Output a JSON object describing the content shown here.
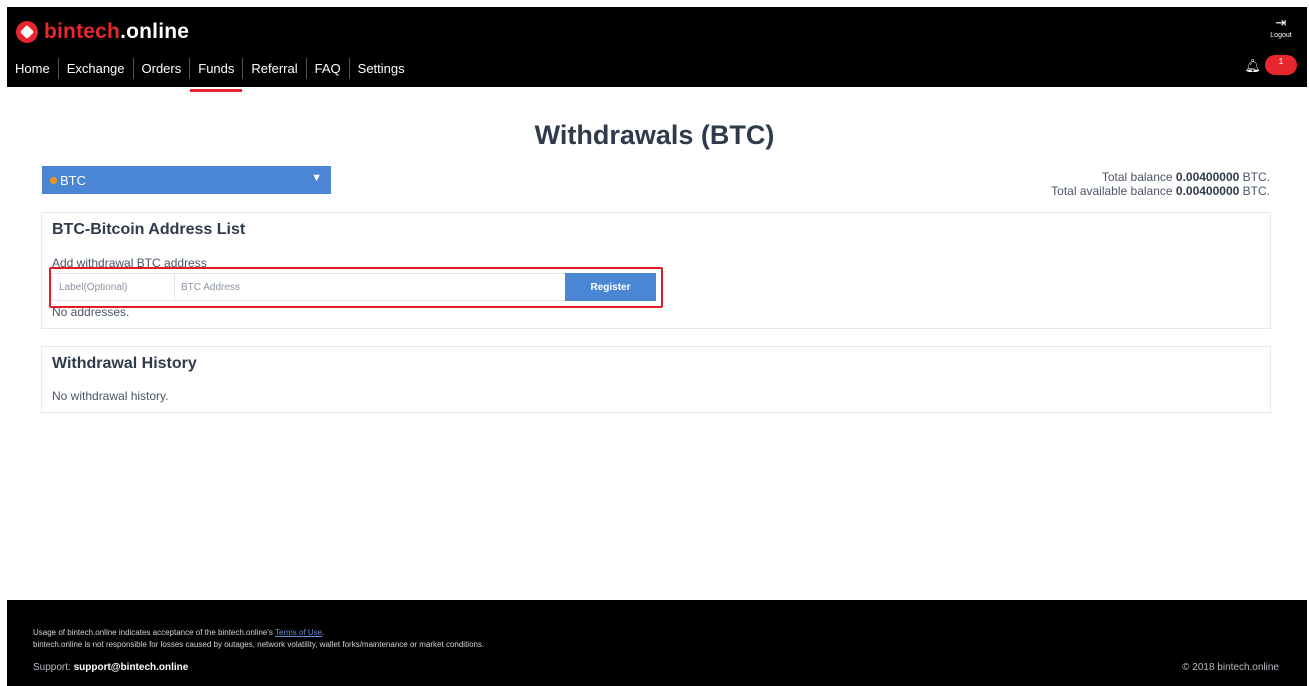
{
  "header": {
    "logo_brand": "bintech",
    "logo_tld": ".online",
    "nav": [
      "Home",
      "Exchange",
      "Orders",
      "Funds",
      "Referral",
      "FAQ",
      "Settings"
    ],
    "active_nav": "Funds",
    "logout_icon": "logout-icon",
    "logout_label": "Logout",
    "bell_icon": "bell-icon",
    "notification_count": "1"
  },
  "page": {
    "title": "Withdrawals (BTC)"
  },
  "currency_select": {
    "value": "BTC",
    "icon": "bitcoin-coin-icon",
    "caret": "▼"
  },
  "balances": {
    "total_label": "Total balance",
    "total_value": "0.00400000",
    "total_unit": "BTC.",
    "available_label": "Total available balance",
    "available_value": "0.00400000",
    "available_unit": "BTC."
  },
  "address_list": {
    "title": "BTC-Bitcoin Address List",
    "add_label": "Add withdrawal BTC address",
    "label_placeholder": "Label(Optional)",
    "address_placeholder": "BTC Address",
    "register_label": "Register",
    "empty_text": "No addresses."
  },
  "withdrawal_history": {
    "title": "Withdrawal History",
    "empty_text": "No withdrawal history."
  },
  "footer": {
    "usage_text": "Usage of bintech.online indicates acceptance of the bintech.online's",
    "terms_link": "Terms of Use",
    "usage_end": ".",
    "disclaimer": "bintech.online is not responsible for losses caused by outages, network volatility, wallet forks/maintenance or market conditions.",
    "support_label": "Support:",
    "support_email": "support@bintech.online",
    "copyright": "© 2018 bintech.online"
  },
  "colors": {
    "brand_red": "#e8262d",
    "accent_blue": "#4a86d4",
    "highlight_red": "#e31b23",
    "header_bg": "#000000"
  }
}
